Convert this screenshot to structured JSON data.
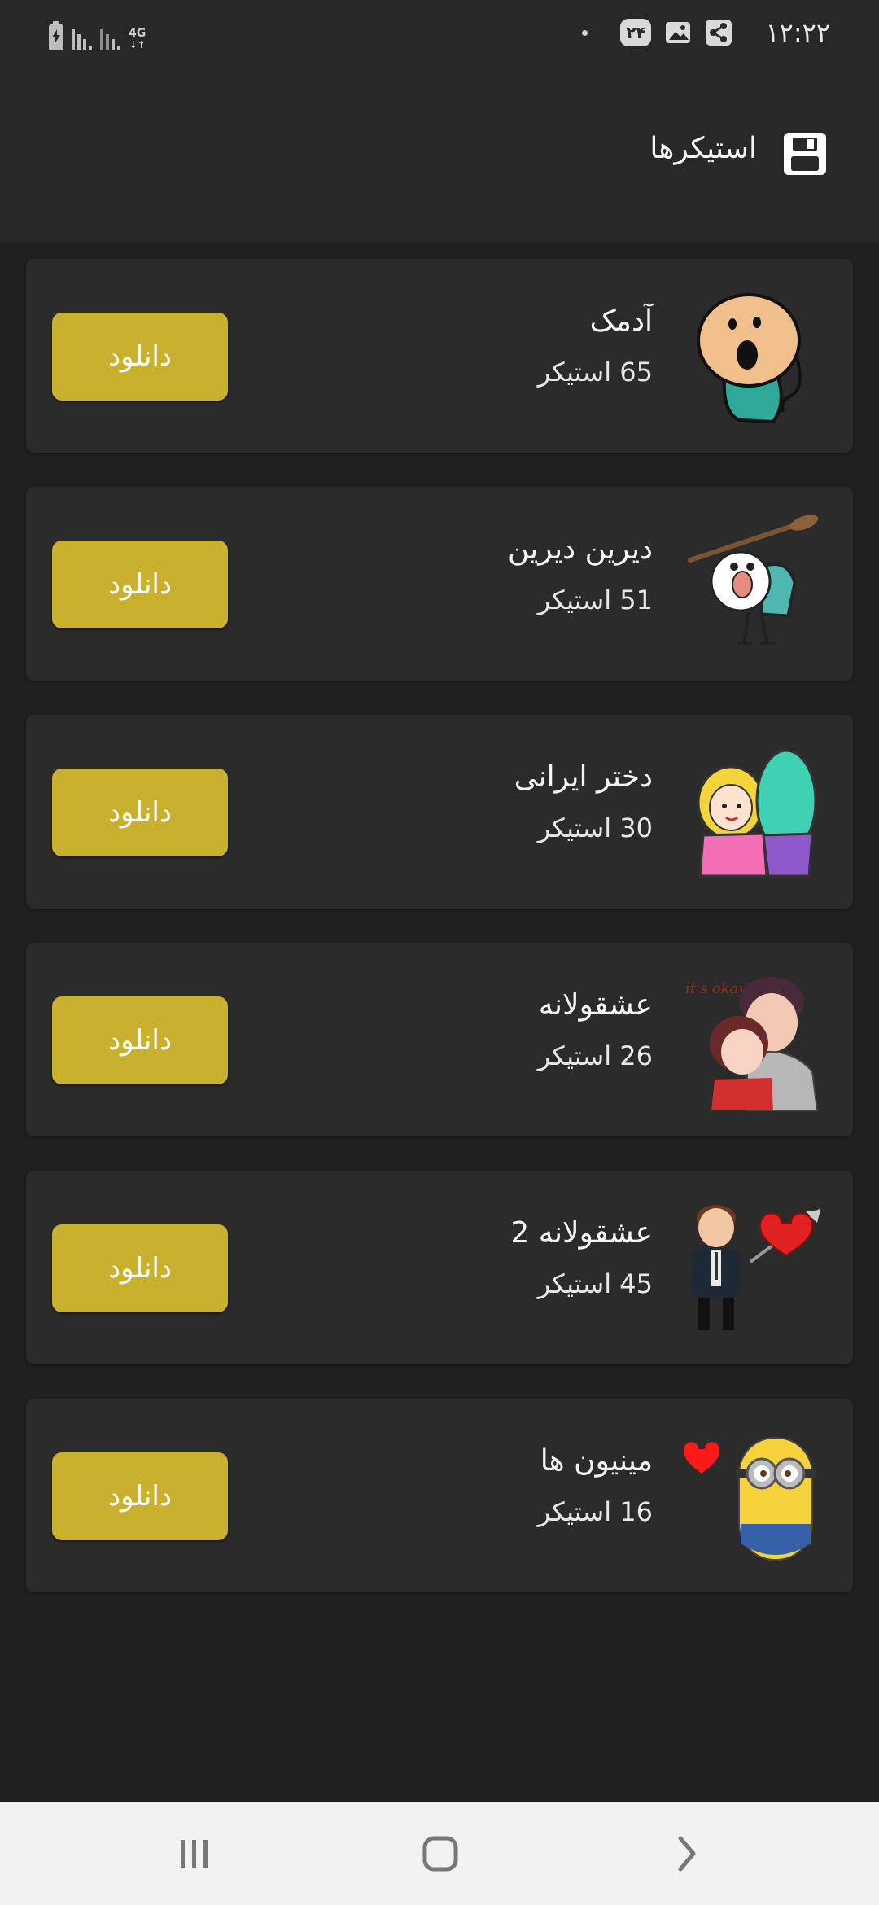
{
  "status_bar": {
    "time": "۱۲:۲۲",
    "badge": "۲۴",
    "network": "4G",
    "icons": [
      "battery-charging-icon",
      "signal-icon",
      "signal-icon",
      "network-4g-icon",
      "dot-icon",
      "badge-icon",
      "gallery-icon",
      "share-icon"
    ]
  },
  "app_bar": {
    "title": "استیکرها",
    "icon": "save-icon"
  },
  "packs": [
    {
      "name": "آدمک",
      "count": "65 استیکر",
      "button": "دانلود",
      "thumb": "stick-figure-sticker"
    },
    {
      "name": "دیرین دیرین",
      "count": "51 استیکر",
      "button": "دانلود",
      "thumb": "old-man-sticker"
    },
    {
      "name": "دختر ایرانی",
      "count": "30 استیکر",
      "button": "دانلود",
      "thumb": "iranian-girl-sticker"
    },
    {
      "name": "عشقولانه",
      "count": "26 استیکر",
      "button": "دانلود",
      "thumb": "couple-sticker",
      "thumb_text": "it's okay"
    },
    {
      "name": "عشقولانه 2",
      "count": "45 استیکر",
      "button": "دانلود",
      "thumb": "man-heart-sticker"
    },
    {
      "name": "مینیون ها",
      "count": "16 استیکر",
      "button": "دانلود",
      "thumb": "minion-sticker"
    }
  ],
  "nav_bar": {
    "items": [
      "recent-apps-icon",
      "home-icon",
      "back-icon"
    ]
  },
  "colors": {
    "background": "#202020",
    "card": "#2b2b2b",
    "app_bar": "#282828",
    "button": "#c9b02f",
    "nav_bar": "#f2f2f2"
  }
}
